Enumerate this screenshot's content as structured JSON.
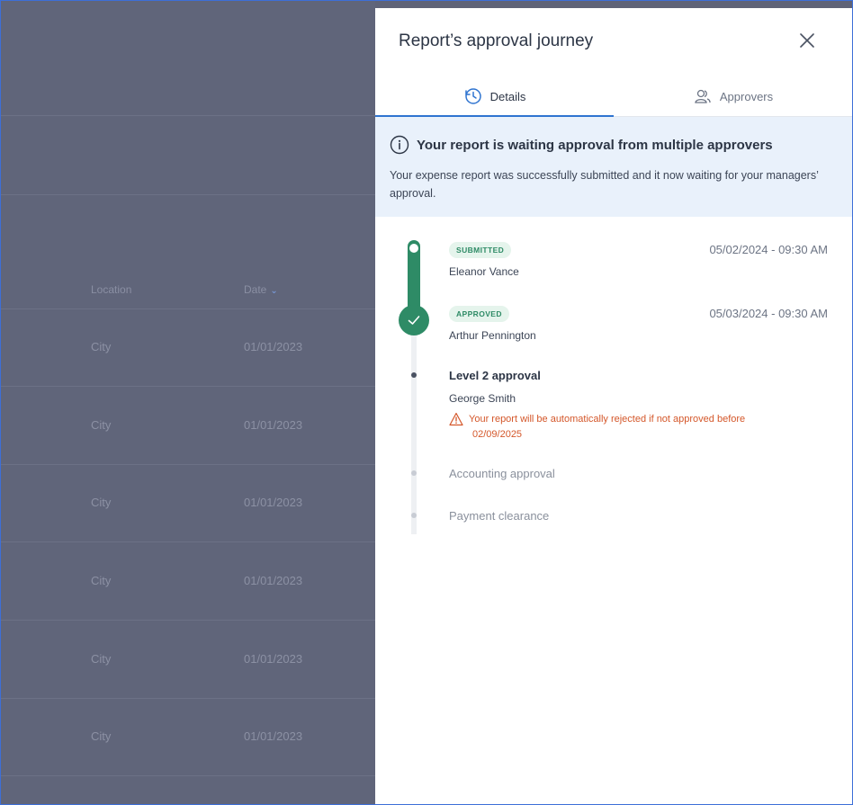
{
  "background": {
    "columns": {
      "location": "Location",
      "date": "Date"
    },
    "rows": [
      {
        "location": "City",
        "date": "01/01/2023"
      },
      {
        "location": "City",
        "date": "01/01/2023"
      },
      {
        "location": "City",
        "date": "01/01/2023"
      },
      {
        "location": "City",
        "date": "01/01/2023"
      },
      {
        "location": "City",
        "date": "01/01/2023"
      },
      {
        "location": "City",
        "date": "01/01/2023"
      }
    ]
  },
  "panel": {
    "title": "Report’s approval journey",
    "tabs": {
      "details": "Details",
      "approvers": "Approvers"
    },
    "info": {
      "title": "Your report is waiting approval from multiple approvers",
      "text": "Your expense report was successfully submitted and it now waiting for your managers’ approval."
    },
    "timeline": {
      "submitted": {
        "badge": "SUBMITTED",
        "date": "05/02/2024 - 09:30 AM",
        "name": "Eleanor Vance"
      },
      "approved": {
        "badge": "APPROVED",
        "date": "05/03/2024 - 09:30 AM",
        "name": "Arthur Pennington"
      },
      "level2": {
        "title": "Level 2 approval",
        "name": "George Smith",
        "warning_line1": "Your report will be automatically rejected if not approved before",
        "warning_line2": "02/09/2025"
      },
      "accounting": "Accounting approval",
      "payment": "Payment clearance"
    }
  },
  "colors": {
    "accent": "#2f74d0",
    "success": "#2e8b66",
    "warning": "#d4572a",
    "info_bg": "#e9f1fb"
  }
}
